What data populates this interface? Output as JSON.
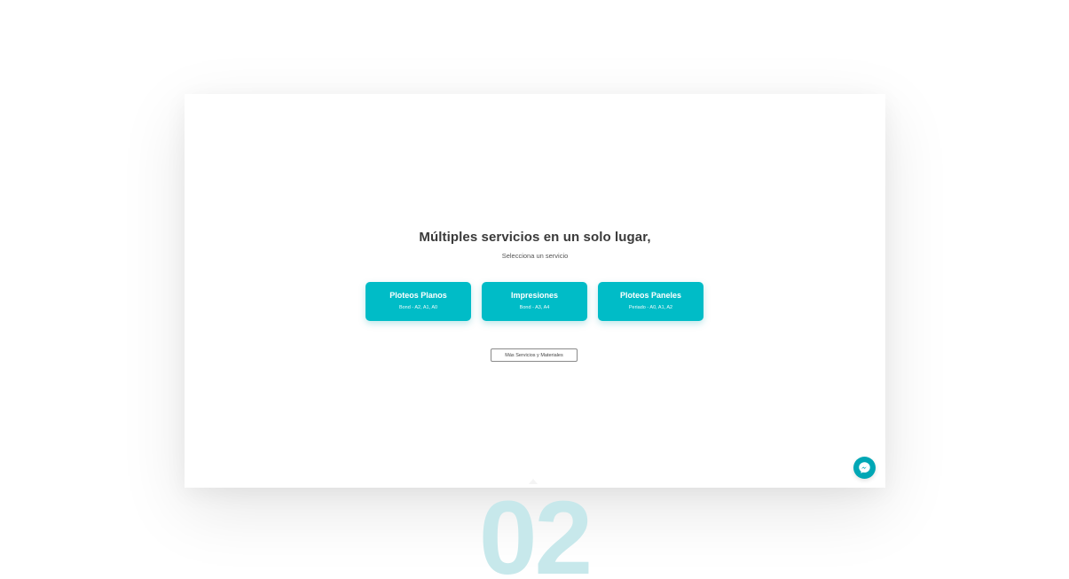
{
  "colors": {
    "accent": "#00bcc7",
    "messenger": "#00a7b5",
    "step_number": "#c7e8eb",
    "headline": "#3a3a3a"
  },
  "hero": {
    "title": "Múltiples servicios en un solo lugar,",
    "subtitle": "Selecciona un servicio"
  },
  "services": [
    {
      "title": "Ploteos Planos",
      "detail": "Bond - A2, A1, A0"
    },
    {
      "title": "Impresiones",
      "detail": "Bond - A3, A4"
    },
    {
      "title": "Ploteos Paneles",
      "detail": "Periado - A0, A1, A2"
    }
  ],
  "more_button": {
    "label": "Más Servicios y Materiales"
  },
  "chat": {
    "icon": "messenger-icon"
  },
  "step": {
    "number": "02"
  }
}
